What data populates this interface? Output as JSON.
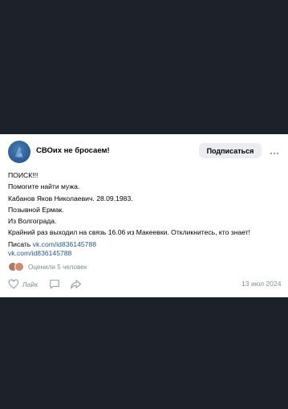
{
  "post": {
    "community_name": "СВОих не бросаем!",
    "subscribe_label": "Подписаться",
    "text_lines": [
      "ПОИСК!!!",
      "Помогите найти мужа.",
      "Кабанов Яков Николаевич. 28.09.1983.",
      "Позывной Ермак.",
      "Из Волгограда.",
      "Крайний раз выходил на связь 16.06 из Макеевки. Откликнитесь, кто знает!"
    ],
    "contact_prefix": "Писать ",
    "contact_link": "vk.com/id836145788",
    "link_preview": "vk.com/id836145788",
    "reactions_text": "Оценили 5 человек",
    "like_label": "Лайк",
    "date": "13 июл 2024"
  },
  "colors": {
    "page_background": "#1d2129",
    "card_background": "#ffffff",
    "link": "#2a5885",
    "muted_text": "#818c99",
    "button_background": "#ebedf0"
  },
  "icons": {
    "more": "more-horizontal-icon",
    "like": "heart-icon",
    "comment": "comment-icon",
    "share": "share-icon"
  }
}
